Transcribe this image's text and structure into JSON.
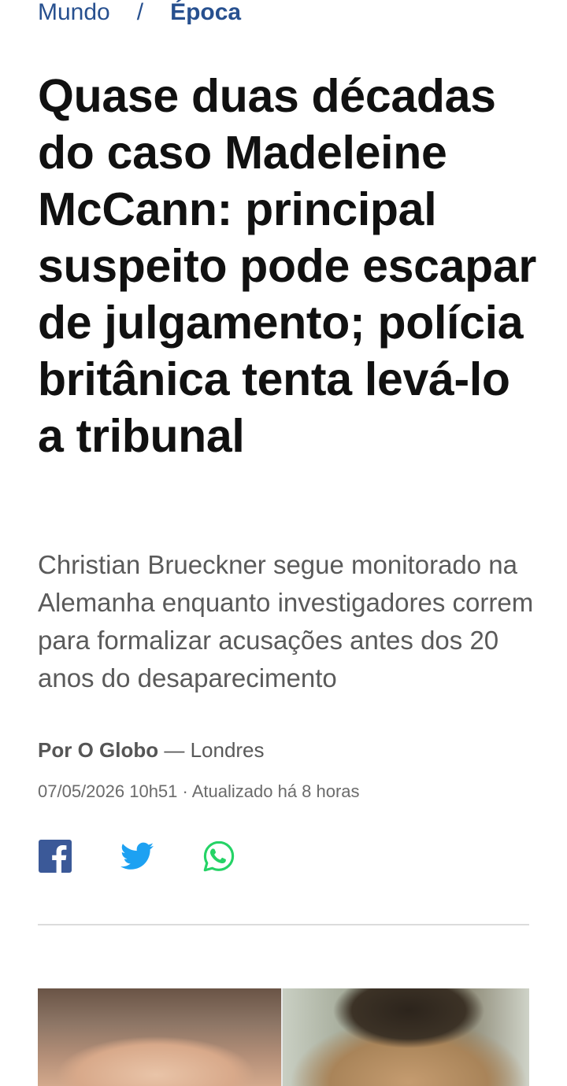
{
  "breadcrumb": {
    "first": "Mundo",
    "separator": "/",
    "second": "Época"
  },
  "article": {
    "headline": "Quase duas décadas do caso Madeleine McCann: principal suspeito pode escapar de julgamento; polícia britânica tenta levá-lo a tribunal",
    "subtitle": "Christian Brueckner segue monitorado na Alemanha enquanto investigadores correm para formalizar acusações antes dos 20 anos do desaparecimento",
    "author": "Por O Globo",
    "location_sep": " — ",
    "location": "Londres",
    "dateline": "07/05/2026 10h51 · Atualizado há 8 horas"
  },
  "share": {
    "facebook_icon": "facebook-icon",
    "twitter_icon": "twitter-icon",
    "whatsapp_icon": "whatsapp-icon"
  },
  "colors": {
    "brand_blue": "#27508f",
    "facebook": "#3b5998",
    "twitter": "#1da1f2",
    "whatsapp": "#25d366"
  }
}
